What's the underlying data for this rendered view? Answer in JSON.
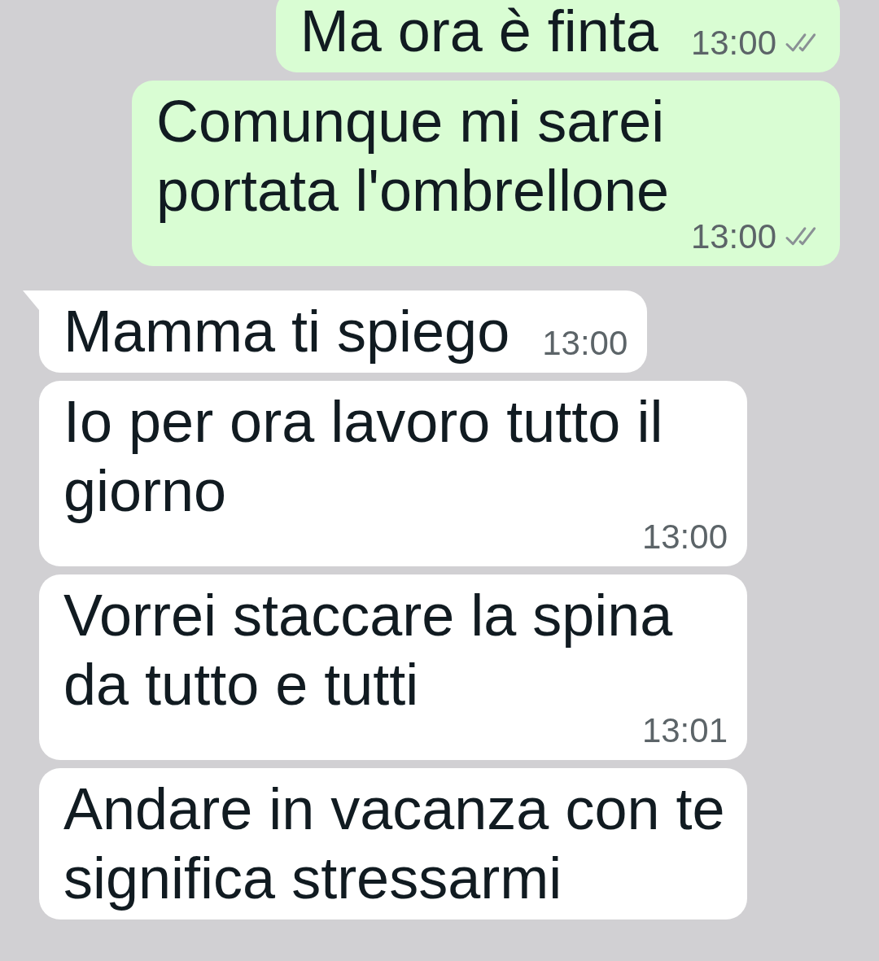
{
  "messages": [
    {
      "kind": "sent",
      "text": "Ma ora è finta",
      "time": "13:00",
      "tail": false
    },
    {
      "kind": "sent",
      "text": "Comunque mi sarei portata l'ombrellone",
      "time": "13:00",
      "tail": false
    },
    {
      "kind": "received",
      "text": "Mamma ti spiego",
      "time": "13:00",
      "tail": true
    },
    {
      "kind": "received",
      "text": "Io per ora lavoro tutto il giorno",
      "time": "13:00",
      "tail": false
    },
    {
      "kind": "received",
      "text": "Vorrei staccare la spina da tutto e tutti",
      "time": "13:01",
      "tail": false
    },
    {
      "kind": "received",
      "text": "Andare in vacanza con te significa stressarmi",
      "tail": false
    }
  ]
}
